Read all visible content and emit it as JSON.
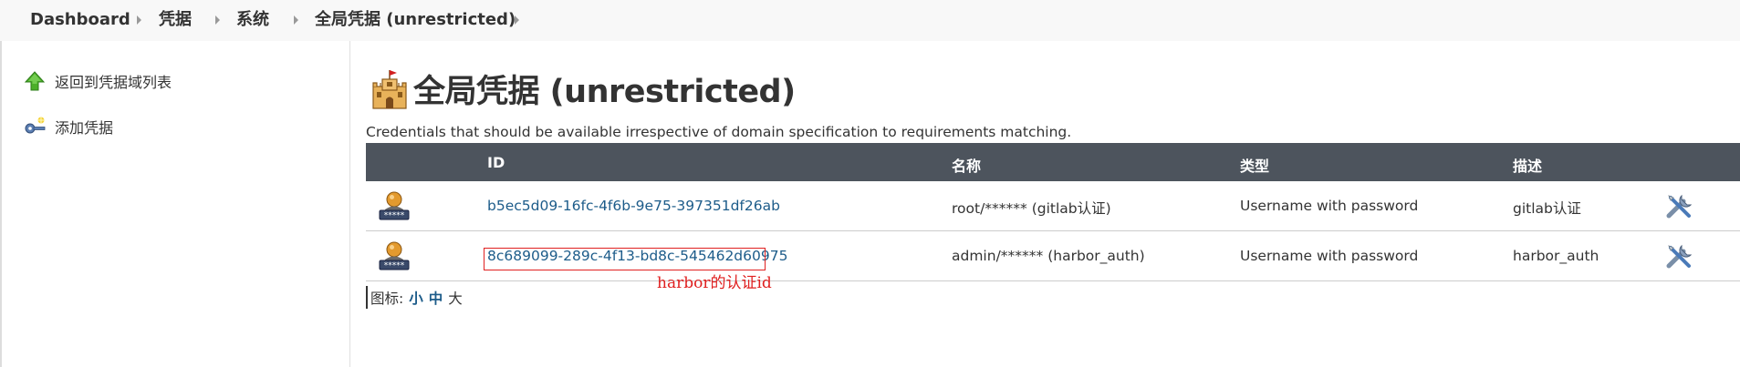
{
  "breadcrumb": {
    "items": [
      "Dashboard",
      "凭据",
      "系统",
      "全局凭据 (unrestricted)"
    ]
  },
  "sidebar": {
    "items": [
      {
        "label": "返回到凭据域列表",
        "icon": "green-up-arrow-icon"
      },
      {
        "label": "添加凭据",
        "icon": "key-add-icon"
      }
    ]
  },
  "main": {
    "title": "全局凭据 (unrestricted)",
    "title_icon": "castle-icon",
    "description": "Credentials that should be available irrespective of domain specification to requirements matching.",
    "table": {
      "headers": [
        "ID",
        "名称",
        "类型",
        "描述"
      ],
      "rows": [
        {
          "id": "b5ec5d09-16fc-4f6b-9e75-397351df26ab",
          "name": "root/****** (gitlab认证)",
          "type": "Username with password",
          "description": "gitlab认证"
        },
        {
          "id": "8c689099-289c-4f13-bd8c-545462d60975",
          "name": "admin/****** (harbor_auth)",
          "type": "Username with password",
          "description": "harbor_auth"
        }
      ]
    },
    "annotation": "harbor的认证id",
    "icon_size": {
      "label": "图标:",
      "options": [
        "小",
        "中",
        "大"
      ]
    }
  },
  "colors": {
    "header_bg": "#4d545d",
    "link": "#1d5c8a",
    "annotation": "#e02020"
  }
}
